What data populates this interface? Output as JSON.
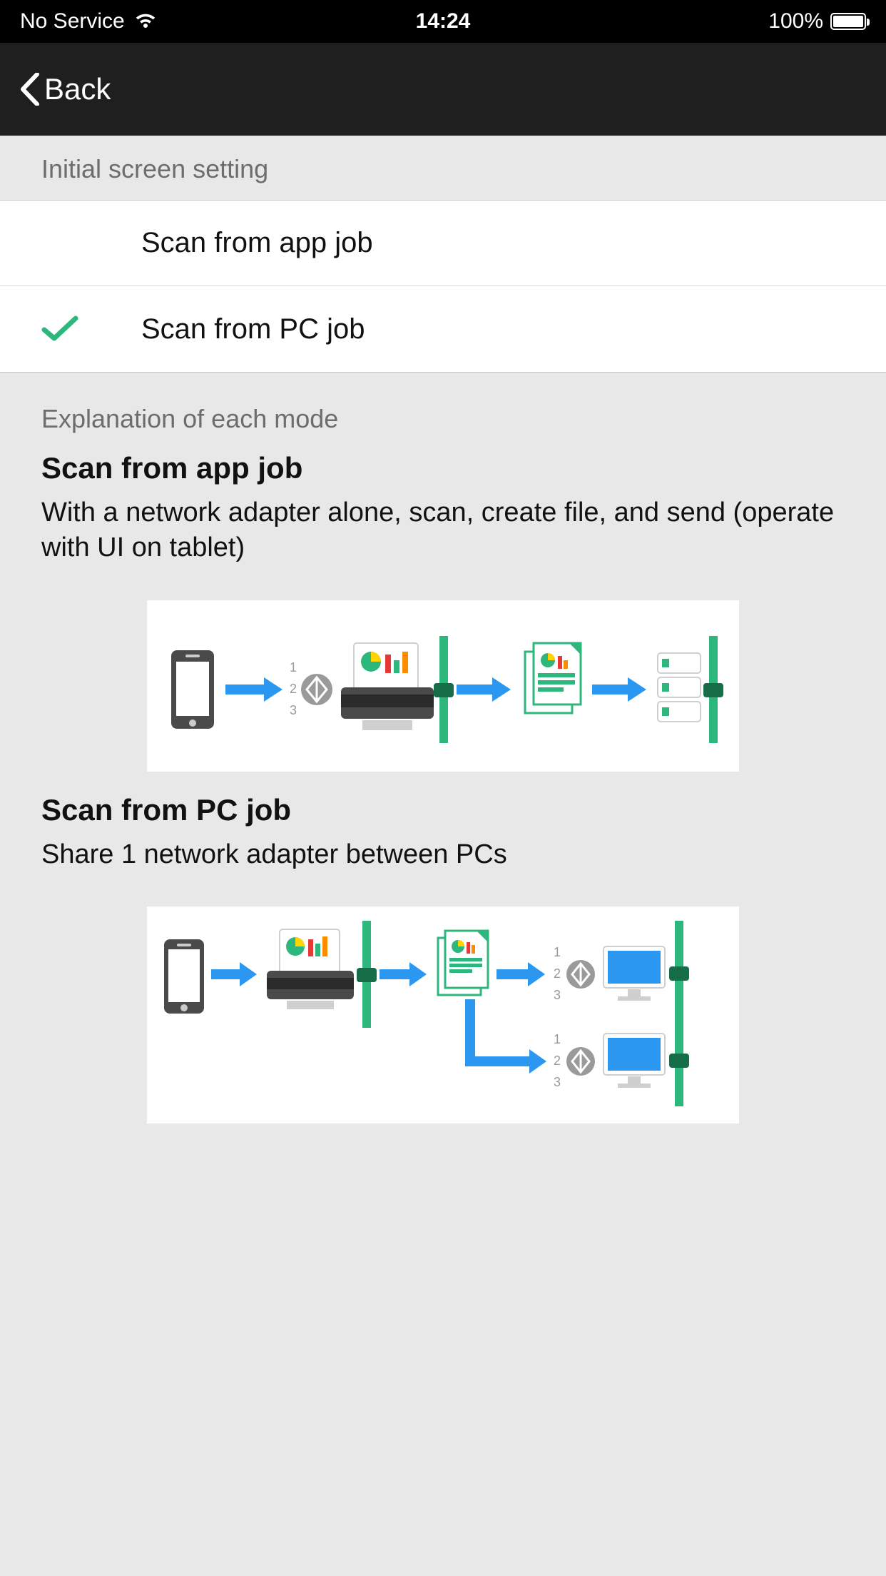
{
  "status": {
    "service": "No Service",
    "time": "14:24",
    "battery": "100%"
  },
  "nav": {
    "back": "Back"
  },
  "sections": {
    "initial": "Initial screen setting",
    "explain": "Explanation of each mode"
  },
  "options": [
    {
      "label": "Scan from app job",
      "selected": false
    },
    {
      "label": "Scan from PC job",
      "selected": true
    }
  ],
  "explain": {
    "app": {
      "title": "Scan from app job",
      "text": "With a network adapter alone, scan, create file, and send (operate with UI on tablet)"
    },
    "pc": {
      "title": "Scan from PC job",
      "text": "Share 1 network adapter between PCs"
    }
  }
}
